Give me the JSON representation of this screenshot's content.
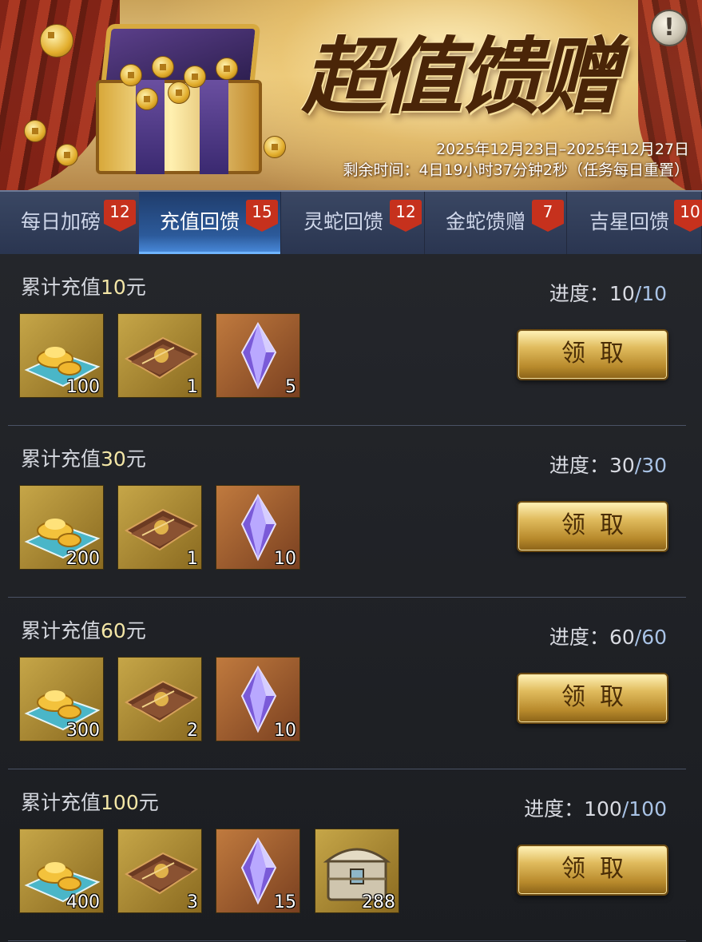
{
  "banner": {
    "title": "超值馈赠",
    "date_range": "2025年12月23日–2025年12月27日",
    "remaining": "剩余时间：4日19小时37分钟2秒（任务每日重置）",
    "info_icon": "exclamation-icon"
  },
  "tabs": [
    {
      "label": "每日加磅",
      "badge": "12",
      "active": false
    },
    {
      "label": "充值回馈",
      "badge": "15",
      "active": true
    },
    {
      "label": "灵蛇回馈",
      "badge": "12",
      "active": false
    },
    {
      "label": "金蛇馈赠",
      "badge": "7",
      "active": false
    },
    {
      "label": "吉星回馈",
      "badge": "10",
      "active": false
    }
  ],
  "rows": [
    {
      "prefix": "累计充值",
      "amount": "10",
      "suffix": "元",
      "progress_label": "进度：",
      "progress_current": "10",
      "progress_sep": "/",
      "progress_total": "10",
      "items": [
        {
          "icon": "gold-ingot-icon",
          "count": "100"
        },
        {
          "icon": "scroll-book-icon",
          "count": "1"
        },
        {
          "icon": "purple-crystal-icon",
          "count": "5"
        }
      ],
      "button": "领取"
    },
    {
      "prefix": "累计充值",
      "amount": "30",
      "suffix": "元",
      "progress_label": "进度：",
      "progress_current": "30",
      "progress_sep": "/",
      "progress_total": "30",
      "items": [
        {
          "icon": "gold-ingot-icon",
          "count": "200"
        },
        {
          "icon": "scroll-book-icon",
          "count": "1"
        },
        {
          "icon": "purple-crystal-icon",
          "count": "10"
        }
      ],
      "button": "领取"
    },
    {
      "prefix": "累计充值",
      "amount": "60",
      "suffix": "元",
      "progress_label": "进度：",
      "progress_current": "60",
      "progress_sep": "/",
      "progress_total": "60",
      "items": [
        {
          "icon": "gold-ingot-icon",
          "count": "300"
        },
        {
          "icon": "scroll-book-icon",
          "count": "2"
        },
        {
          "icon": "purple-crystal-icon",
          "count": "10"
        }
      ],
      "button": "领取"
    },
    {
      "prefix": "累计充值",
      "amount": "100",
      "suffix": "元",
      "progress_label": "进度：",
      "progress_current": "100",
      "progress_sep": "/",
      "progress_total": "100",
      "items": [
        {
          "icon": "gold-ingot-icon",
          "count": "400"
        },
        {
          "icon": "scroll-book-icon",
          "count": "3"
        },
        {
          "icon": "purple-crystal-icon",
          "count": "15"
        },
        {
          "icon": "treasure-chest-icon",
          "count": "288"
        }
      ],
      "button": "领取"
    }
  ]
}
